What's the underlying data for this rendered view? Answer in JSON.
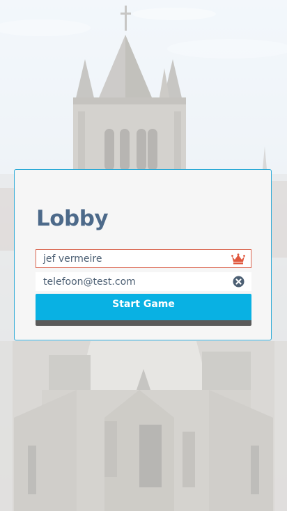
{
  "lobby": {
    "title": "Lobby",
    "players": [
      {
        "name": "jef vermeire",
        "role": "host",
        "icon": "crown-icon"
      },
      {
        "name": "telefoon@test.com",
        "role": "guest",
        "icon": "remove-circle-icon"
      }
    ],
    "start_label": "Start Game"
  },
  "colors": {
    "accent": "#09b1e3",
    "title": "#4d6a8a",
    "host_border": "#d9604a",
    "crown": "#e0573d",
    "remove_icon": "#4c5f73"
  }
}
